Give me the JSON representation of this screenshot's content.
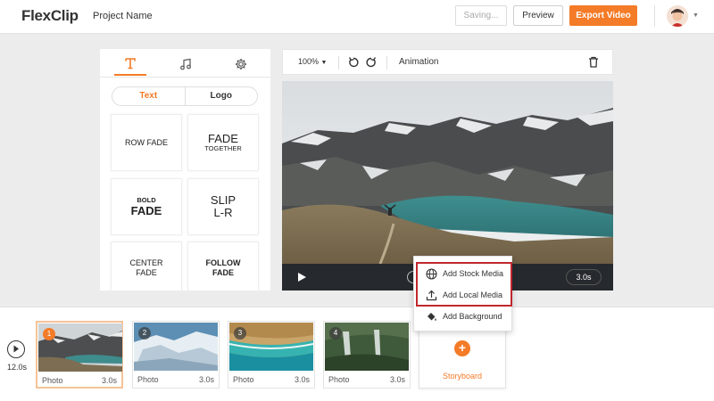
{
  "app": {
    "logo_text": "FlexClip",
    "project_name": "Project Name"
  },
  "header": {
    "saving_label": "Saving...",
    "preview_label": "Preview",
    "export_label": "Export Video"
  },
  "left_panel": {
    "tabs": [
      {
        "icon": "text-icon",
        "active": true
      },
      {
        "icon": "music-icon",
        "active": false
      },
      {
        "icon": "settings-icon",
        "active": false
      }
    ],
    "segment": {
      "text_label": "Text",
      "logo_label": "Logo",
      "selected": "Text"
    },
    "cards": [
      {
        "line1": "ROW FADE",
        "line2": ""
      },
      {
        "line1": "FADE",
        "line2": "TOGETHER"
      },
      {
        "line1": "BOLD",
        "line2": "FADE"
      },
      {
        "line1": "SLIP",
        "line2": "L-R"
      },
      {
        "line1": "CENTER",
        "line2": "FADE"
      },
      {
        "line1": "FOLLOW",
        "line2": "FADE"
      }
    ]
  },
  "toolbar": {
    "zoom": "100%",
    "animation_label": "Animation"
  },
  "preview": {
    "duration": "3.0s"
  },
  "menu": {
    "items": [
      {
        "label": "Add Stock Media",
        "icon": "globe-icon"
      },
      {
        "label": "Add Local Media",
        "icon": "upload-icon"
      },
      {
        "label": "Add Background",
        "icon": "paint-bucket-icon"
      }
    ]
  },
  "storyboard": {
    "total_duration": "12.0s",
    "clips": [
      {
        "number": "1",
        "type": "Photo",
        "duration": "3.0s",
        "selected": true
      },
      {
        "number": "2",
        "type": "Photo",
        "duration": "3.0s",
        "selected": false
      },
      {
        "number": "3",
        "type": "Photo",
        "duration": "3.0s",
        "selected": false
      },
      {
        "number": "4",
        "type": "Photo",
        "duration": "3.0s",
        "selected": false
      }
    ],
    "add_label": "Storyboard"
  },
  "colors": {
    "accent": "#f47b27",
    "highlight": "#c0272d"
  }
}
